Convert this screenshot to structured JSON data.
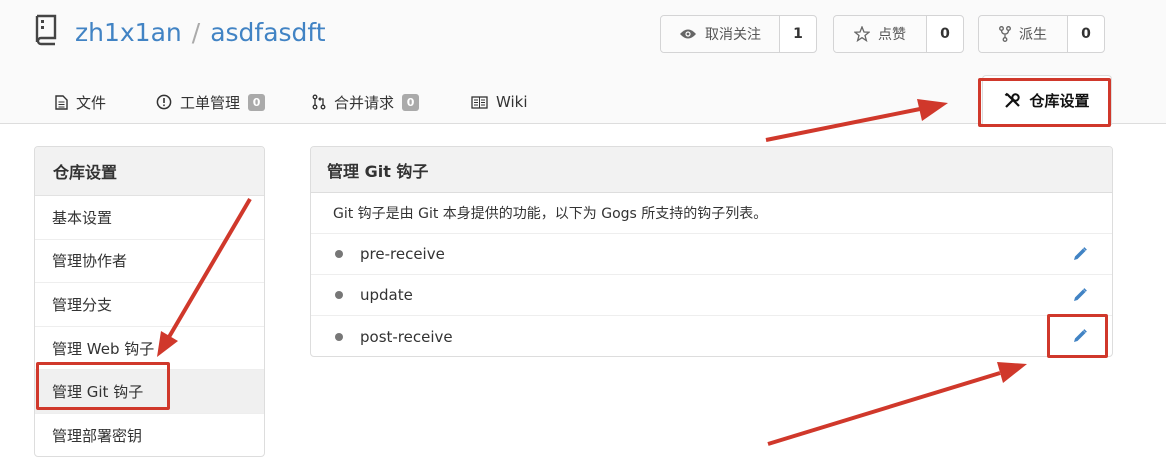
{
  "repo": {
    "owner": "zh1x1an",
    "separator": "/",
    "name": "asdfasdft"
  },
  "actions": [
    {
      "label": "取消关注",
      "count": "1",
      "icon": "eye-icon"
    },
    {
      "label": "点赞",
      "count": "0",
      "icon": "star-icon"
    },
    {
      "label": "派生",
      "count": "0",
      "icon": "fork-icon"
    }
  ],
  "tabs": [
    {
      "label": "文件",
      "icon": "file-icon"
    },
    {
      "label": "工单管理",
      "badge": "0",
      "icon": "issue-icon"
    },
    {
      "label": "合并请求",
      "badge": "0",
      "icon": "pull-request-icon"
    },
    {
      "label": "Wiki",
      "icon": "book-icon"
    },
    {
      "label": "仓库设置",
      "icon": "tools-icon"
    }
  ],
  "sidebar": {
    "title": "仓库设置",
    "items": [
      {
        "label": "基本设置"
      },
      {
        "label": "管理协作者"
      },
      {
        "label": "管理分支"
      },
      {
        "label": "管理 Web 钩子"
      },
      {
        "label": "管理 Git 钩子"
      },
      {
        "label": "管理部署密钥"
      }
    ],
    "active_index": 4
  },
  "panel": {
    "title": "管理 Git 钩子",
    "description": "Git 钩子是由 Git 本身提供的功能，以下为 Gogs 所支持的钩子列表。",
    "hooks": [
      {
        "name": "pre-receive"
      },
      {
        "name": "update"
      },
      {
        "name": "post-receive"
      }
    ]
  },
  "colors": {
    "link": "#4183c4",
    "annotation": "#d0382b",
    "badge": "#aaaaaa"
  }
}
